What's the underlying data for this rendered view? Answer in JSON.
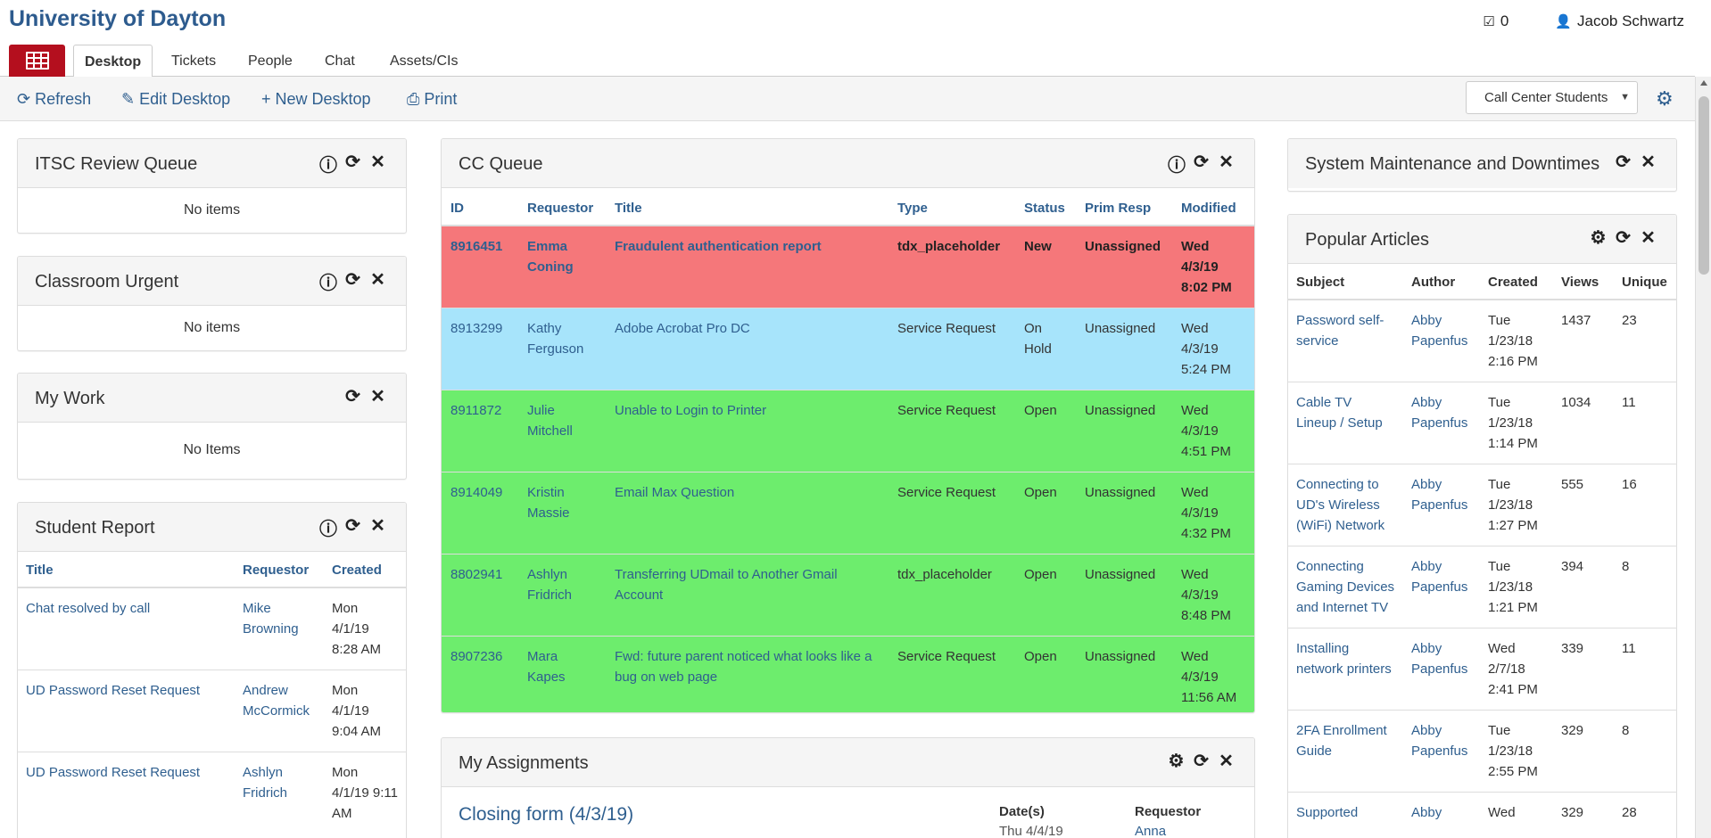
{
  "header": {
    "brand": "University of Dayton",
    "tasks_icon": "check-square-icon",
    "tasks_count": "0",
    "user_icon": "user-icon",
    "user_name": "Jacob Schwartz"
  },
  "tabs": [
    {
      "label": "Desktop",
      "active": true
    },
    {
      "label": "Tickets"
    },
    {
      "label": "People"
    },
    {
      "label": "Chat"
    },
    {
      "label": "Assets/CIs"
    }
  ],
  "toolbar": {
    "refresh": "Refresh",
    "edit": "Edit Desktop",
    "new": "New Desktop",
    "print": "Print",
    "desktop_select": "Call Center Students"
  },
  "colors": {
    "brand": "#2d5b8e",
    "app_button": "#b40f1e",
    "row_new": "#f5777a",
    "row_hold": "#a7e4fb",
    "row_open": "#6ded6d",
    "link": "#2f5f8f"
  },
  "itsc": {
    "title": "ITSC Review Queue",
    "empty": "No items"
  },
  "classroom": {
    "title": "Classroom Urgent",
    "empty": "No items"
  },
  "mywork": {
    "title": "My Work",
    "empty": "No Items"
  },
  "student_report": {
    "title": "Student Report",
    "columns": [
      "Title",
      "Requestor",
      "Created"
    ],
    "rows": [
      {
        "title": "Chat resolved by call",
        "requestor": "Mike Browning",
        "created": "Mon 4/1/19 8:28 AM"
      },
      {
        "title": "UD Password Reset Request",
        "requestor": "Andrew McCormick",
        "created": "Mon 4/1/19 9:04 AM"
      },
      {
        "title": "UD Password Reset Request",
        "requestor": "Ashlyn Fridrich",
        "created": "Mon 4/1/19 9:11 AM"
      }
    ]
  },
  "cc_queue": {
    "title": "CC Queue",
    "columns": [
      "ID",
      "Requestor",
      "Title",
      "Type",
      "Status",
      "Prim Resp",
      "Modified"
    ],
    "rows": [
      {
        "id": "8916451",
        "requestor": "Emma Coning",
        "title": "Fraudulent authentication report",
        "type": "tdx_placeholder",
        "status": "New",
        "resp": "Unassigned",
        "modified": "Wed 4/3/19 8:02 PM",
        "style": "red"
      },
      {
        "id": "8913299",
        "requestor": "Kathy Ferguson",
        "title": "Adobe Acrobat Pro DC",
        "type": "Service Request",
        "status": "On Hold",
        "resp": "Unassigned",
        "modified": "Wed 4/3/19 5:24 PM",
        "style": "blue"
      },
      {
        "id": "8911872",
        "requestor": "Julie Mitchell",
        "title": "Unable to Login to Printer",
        "type": "Service Request",
        "status": "Open",
        "resp": "Unassigned",
        "modified": "Wed 4/3/19 4:51 PM",
        "style": "green"
      },
      {
        "id": "8914049",
        "requestor": "Kristin Massie",
        "title": "Email Max Question",
        "type": "Service Request",
        "status": "Open",
        "resp": "Unassigned",
        "modified": "Wed 4/3/19 4:32 PM",
        "style": "green"
      },
      {
        "id": "8802941",
        "requestor": "Ashlyn Fridrich",
        "title": "Transferring UDmail to Another Gmail Account",
        "type": "tdx_placeholder",
        "status": "Open",
        "resp": "Unassigned",
        "modified": "Wed 4/3/19 8:48 PM",
        "style": "green"
      },
      {
        "id": "8907236",
        "requestor": "Mara Kapes",
        "title": "Fwd: future parent noticed what looks like a bug on web page",
        "type": "Service Request",
        "status": "Open",
        "resp": "Unassigned",
        "modified": "Wed 4/3/19 11:56 AM",
        "style": "green"
      }
    ]
  },
  "assignments": {
    "title": "My Assignments",
    "item_title": "Closing form (4/3/19)",
    "dates_label": "Date(s)",
    "dates_value": "Thu 4/4/19",
    "requestor_label": "Requestor",
    "requestor_value": "Anna"
  },
  "maintenance": {
    "title": "System Maintenance and Downtimes"
  },
  "popular": {
    "title": "Popular Articles",
    "columns": [
      "Subject",
      "Author",
      "Created",
      "Views",
      "Unique"
    ],
    "rows": [
      {
        "subject": "Password self-service",
        "author": "Abby Papenfus",
        "created": "Tue 1/23/18 2:16 PM",
        "views": "1437",
        "unique": "23"
      },
      {
        "subject": "Cable TV Lineup / Setup",
        "author": "Abby Papenfus",
        "created": "Tue 1/23/18 1:14 PM",
        "views": "1034",
        "unique": "11"
      },
      {
        "subject": "Connecting to UD's Wireless (WiFi) Network",
        "author": "Abby Papenfus",
        "created": "Tue 1/23/18 1:27 PM",
        "views": "555",
        "unique": "16"
      },
      {
        "subject": "Connecting Gaming Devices and Internet TV",
        "author": "Abby Papenfus",
        "created": "Tue 1/23/18 1:21 PM",
        "views": "394",
        "unique": "8"
      },
      {
        "subject": "Installing network printers",
        "author": "Abby Papenfus",
        "created": "Wed 2/7/18 2:41 PM",
        "views": "339",
        "unique": "11"
      },
      {
        "subject": "2FA Enrollment Guide",
        "author": "Abby Papenfus",
        "created": "Tue 1/23/18 2:55 PM",
        "views": "329",
        "unique": "8"
      },
      {
        "subject": "Supported",
        "author": "Abby",
        "created": "Wed",
        "views": "329",
        "unique": "28"
      }
    ]
  }
}
